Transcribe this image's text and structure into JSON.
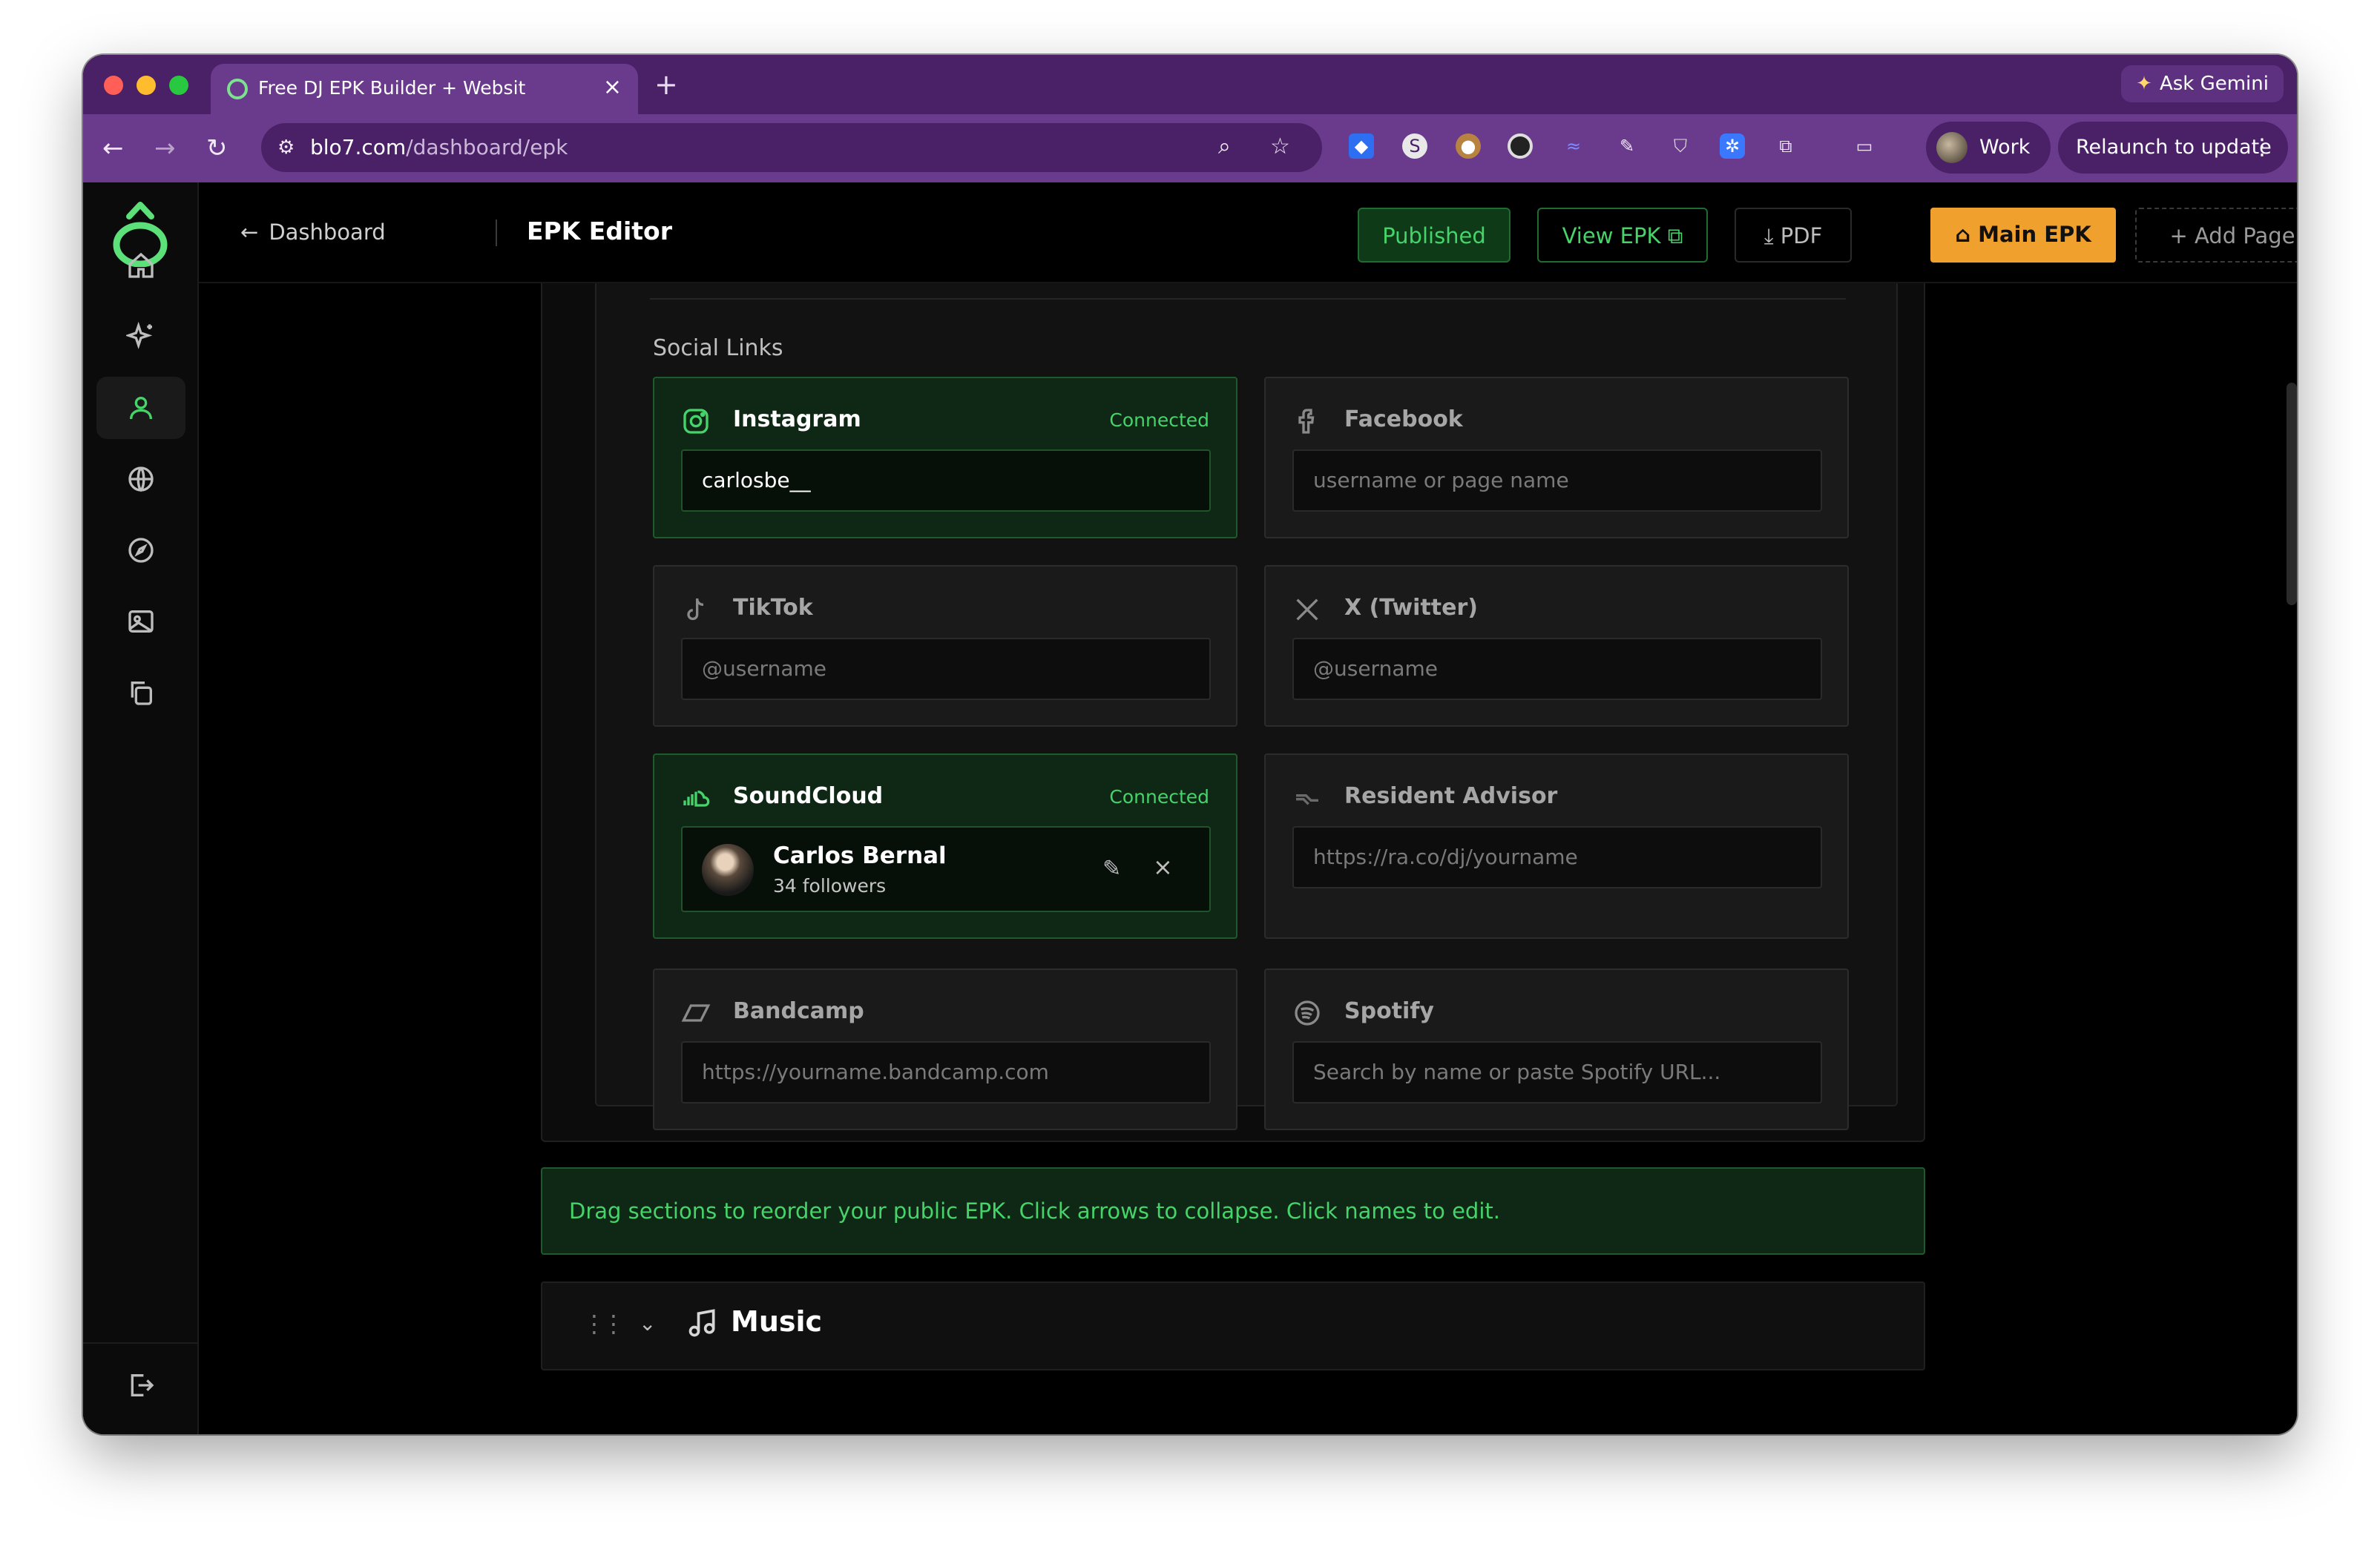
{
  "browser": {
    "tab_title": "Free DJ EPK Builder + Websit",
    "url_host": "blo7.com",
    "url_path": "/dashboard/epk",
    "gemini_label": "Ask Gemini",
    "profile_label": "Work",
    "relaunch_label": "Relaunch to update"
  },
  "header": {
    "back_label": "Dashboard",
    "title": "EPK Editor",
    "published_label": "Published",
    "view_label": "View EPK",
    "pdf_label": "PDF",
    "main_epk_label": "Main EPK",
    "add_page_label": "Add Page"
  },
  "sidebar": {
    "items": [
      {
        "name": "home-icon"
      },
      {
        "name": "sparkles-icon"
      },
      {
        "name": "user-icon",
        "active": true
      },
      {
        "name": "globe-icon"
      },
      {
        "name": "compass-icon"
      },
      {
        "name": "image-icon"
      },
      {
        "name": "copy-icon"
      }
    ],
    "logout_icon": "logout-icon"
  },
  "social": {
    "title": "Social Links",
    "instagram": {
      "name": "Instagram",
      "status": "Connected",
      "value": "carlosbe__"
    },
    "facebook": {
      "name": "Facebook",
      "placeholder": "username or page name"
    },
    "tiktok": {
      "name": "TikTok",
      "placeholder": "@username"
    },
    "twitter": {
      "name": "X (Twitter)",
      "placeholder": "@username"
    },
    "soundcloud": {
      "name": "SoundCloud",
      "status": "Connected",
      "artist": "Carlos Bernal",
      "followers": "34 followers"
    },
    "resident_advisor": {
      "name": "Resident Advisor",
      "placeholder": "https://ra.co/dj/yourname"
    },
    "bandcamp": {
      "name": "Bandcamp",
      "placeholder": "https://yourname.bandcamp.com"
    },
    "spotify": {
      "name": "Spotify",
      "placeholder": "Search by name or paste Spotify URL..."
    }
  },
  "hint": "Drag sections to reorder your public EPK. Click arrows to collapse. Click names to edit.",
  "music_section": {
    "title": "Music"
  },
  "colors": {
    "accent_green": "#46d36a",
    "accent_orange": "#f0a02c",
    "chrome_purple": "#6a3a8c"
  }
}
